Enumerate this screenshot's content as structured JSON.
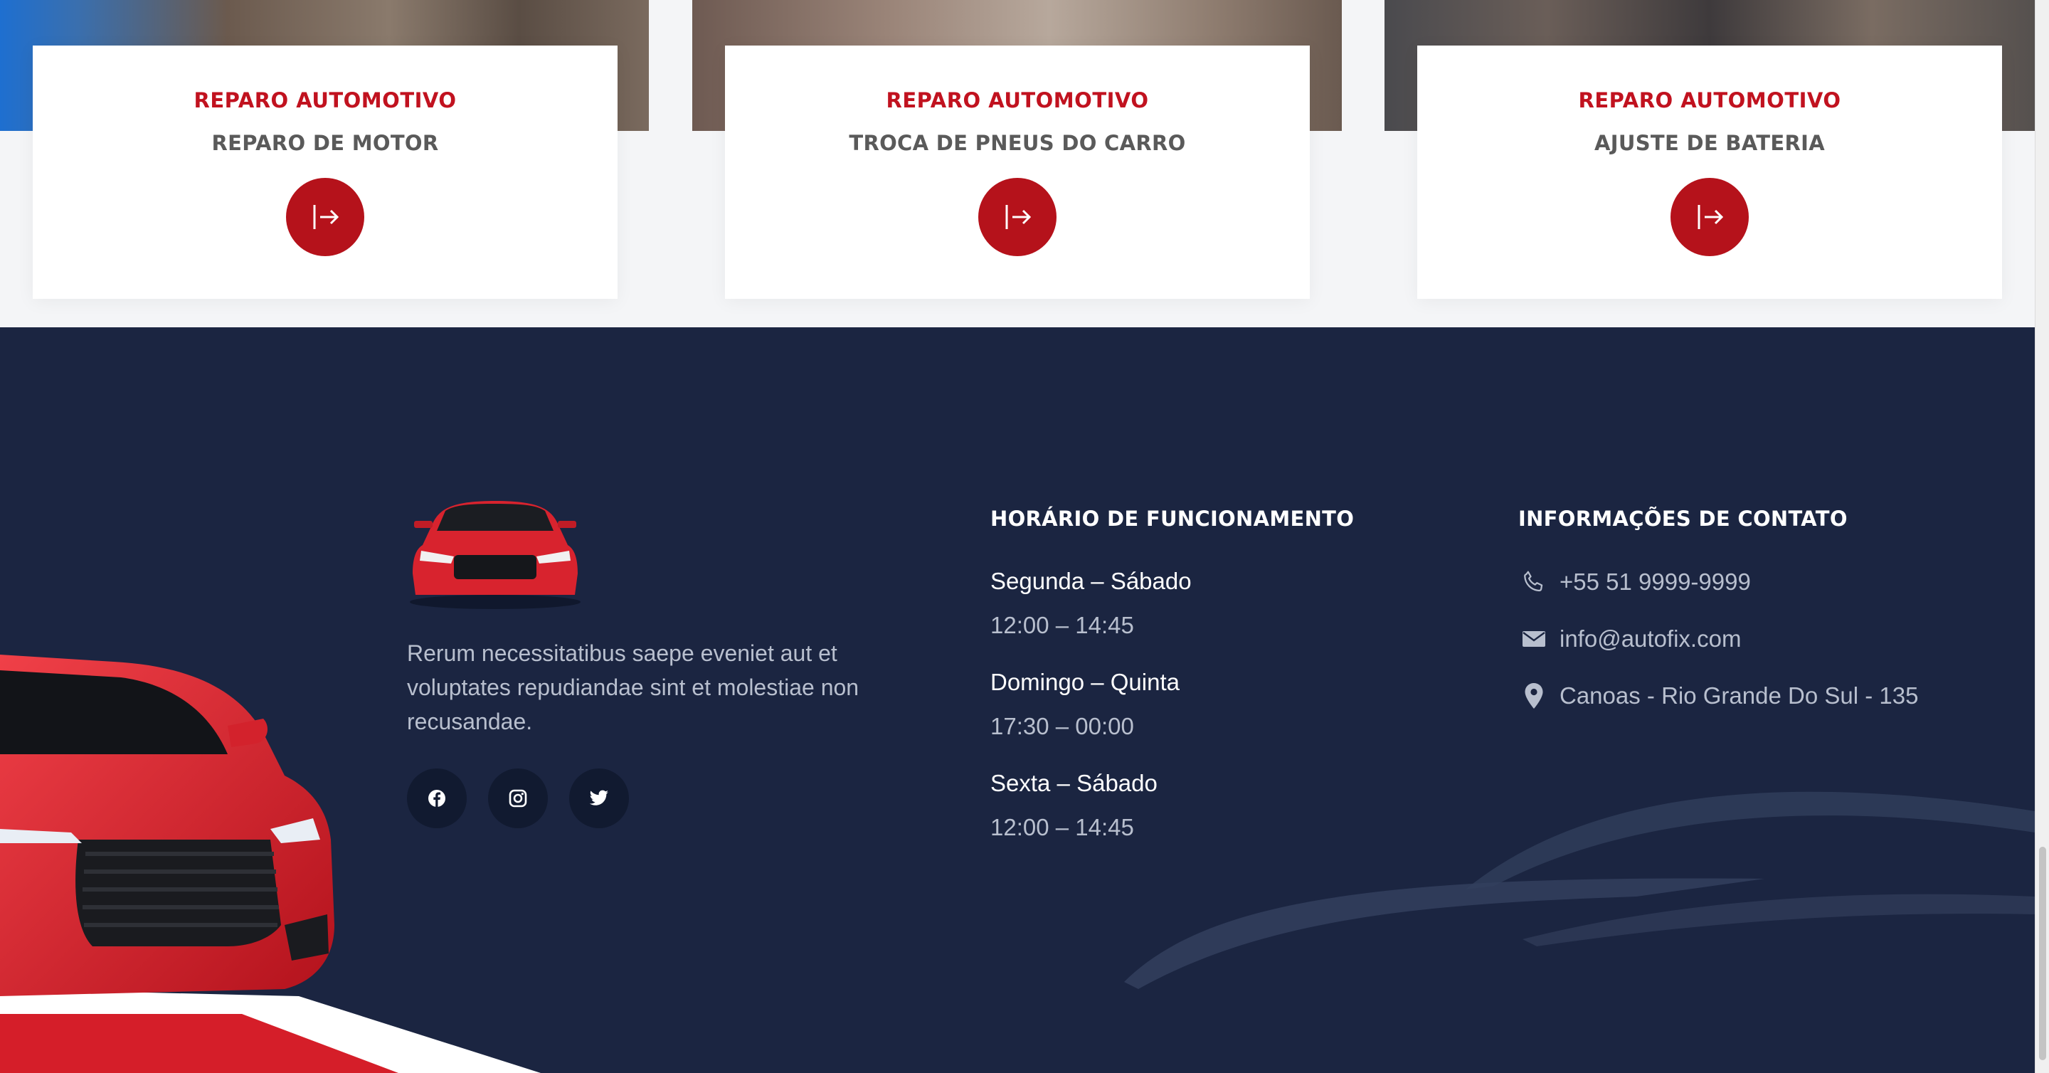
{
  "services": [
    {
      "kicker": "REPARO AUTOMOTIVO",
      "title": "REPARO DE MOTOR"
    },
    {
      "kicker": "REPARO AUTOMOTIVO",
      "title": "TROCA DE PNEUS DO CARRO"
    },
    {
      "kicker": "REPARO AUTOMOTIVO",
      "title": "AJUSTE DE BATERIA"
    }
  ],
  "footer": {
    "description": "Rerum necessitatibus saepe eveniet aut et voluptates repudiandae sint et molestiae non recusandae.",
    "social": [
      {
        "icon": "facebook-icon"
      },
      {
        "icon": "instagram-icon"
      },
      {
        "icon": "twitter-icon"
      }
    ],
    "hours": {
      "heading": "HORÁRIO DE FUNCIONAMENTO",
      "rows": [
        {
          "day": "Segunda – Sábado",
          "time": "12:00 – 14:45"
        },
        {
          "day": "Domingo – Quinta",
          "time": "17:30 – 00:00"
        },
        {
          "day": "Sexta – Sábado",
          "time": "12:00 – 14:45"
        }
      ]
    },
    "contact": {
      "heading": "INFORMAÇÕES DE CONTATO",
      "phone": "+55 51 9999-9999",
      "email": "info@autofix.com",
      "address": "Canoas - Rio Grande Do Sul - 135"
    }
  },
  "colors": {
    "accent": "#b5121b",
    "accent_text": "#c1121f",
    "footer_bg": "#1b2541",
    "social_bg": "#111a30"
  }
}
